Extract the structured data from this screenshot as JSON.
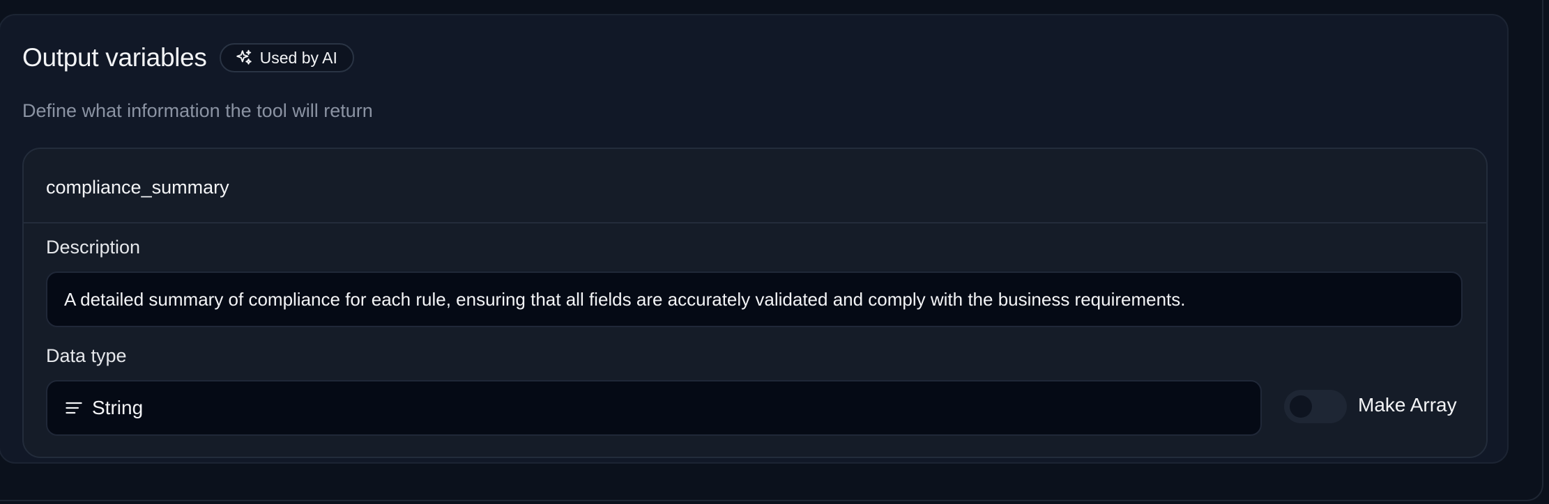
{
  "section": {
    "title": "Output variables",
    "badge_label": "Used by AI",
    "badge_icon": "sparkles-icon",
    "subtitle": "Define what information the tool will return"
  },
  "variable": {
    "name": "compliance_summary",
    "description_label": "Description",
    "description_value": "A detailed summary of compliance for each rule, ensuring that all fields are accurately validated and comply with the business requirements.",
    "data_type_label": "Data type",
    "data_type_value": "String",
    "data_type_icon": "text-lines-icon",
    "make_array_label": "Make Array",
    "make_array_enabled": false
  },
  "colors": {
    "background": "#0b111c",
    "panel": "#111827",
    "card": "#151c28",
    "input": "#050a15",
    "muted_text": "#8b93a3"
  }
}
